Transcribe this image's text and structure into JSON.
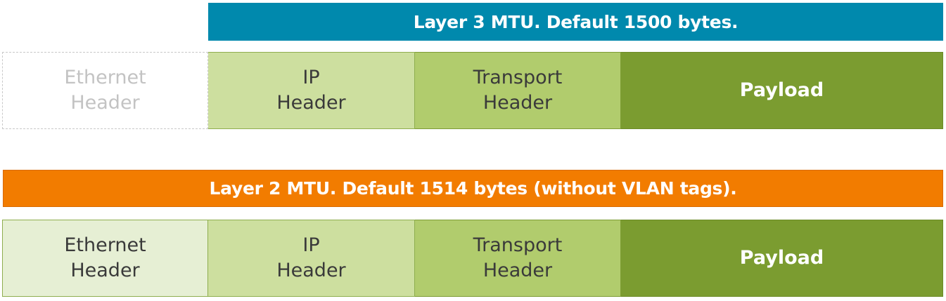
{
  "layer3": {
    "banner": "Layer 3 MTU. Default 1500 bytes.",
    "banner_color": "#0089ad",
    "cells": {
      "ethernet": "Ethernet\nHeader",
      "ip": "IP\nHeader",
      "transport": "Transport\nHeader",
      "payload": "Payload"
    }
  },
  "layer2": {
    "banner": "Layer 2 MTU. Default 1514 bytes (without VLAN tags).",
    "banner_color": "#f27c00",
    "cells": {
      "ethernet": "Ethernet\nHeader",
      "ip": "IP\nHeader",
      "transport": "Transport\nHeader",
      "payload": "Payload"
    }
  },
  "colors": {
    "ethernet_fill": "#e6efd4",
    "ip_fill": "#cddf9f",
    "transport_fill": "#b1cc6d",
    "payload_fill": "#7b9c30"
  }
}
